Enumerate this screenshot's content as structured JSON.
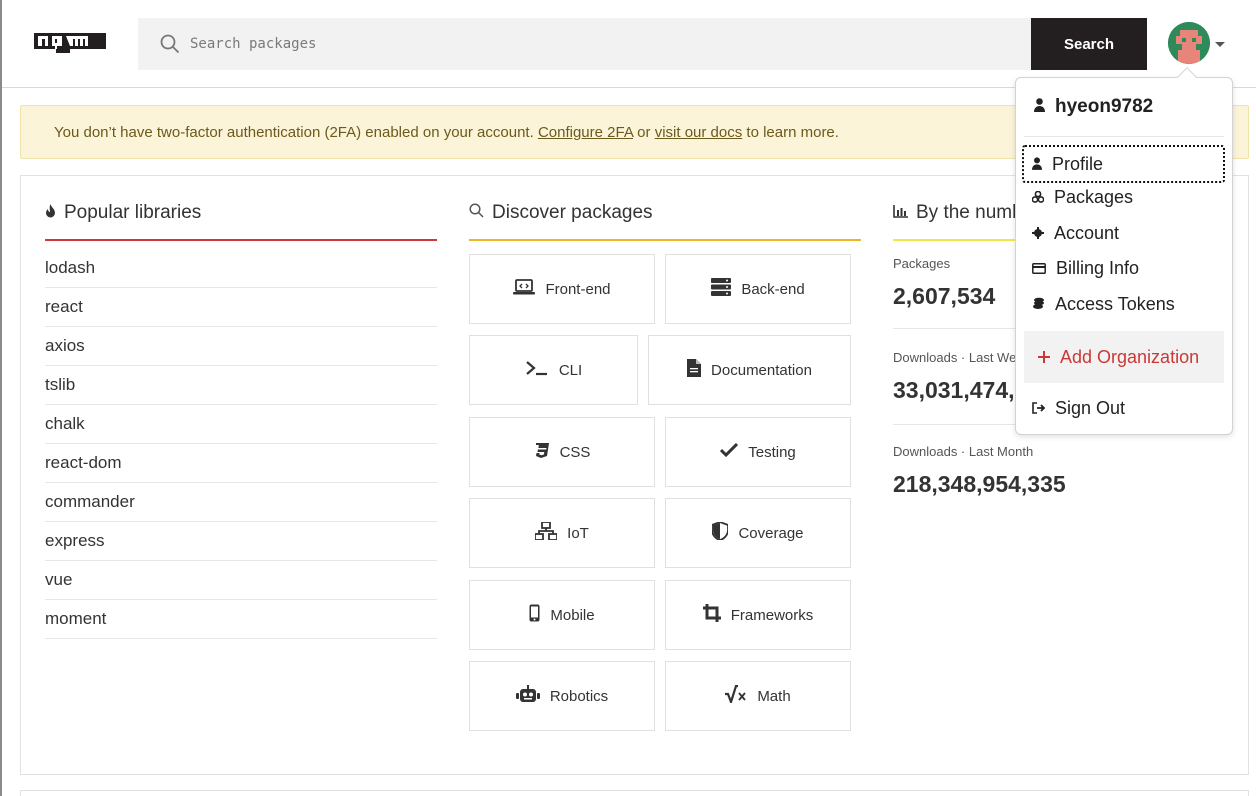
{
  "header": {
    "search_placeholder": "Search packages",
    "search_button": "Search"
  },
  "banner": {
    "text_before": "You don’t have two-factor authentication (2FA) enabled on your account. ",
    "link1": "Configure 2FA",
    "text_mid": " or ",
    "link2": "visit our docs",
    "text_after": " to learn more."
  },
  "popular": {
    "title": "Popular libraries",
    "items": [
      "lodash",
      "react",
      "axios",
      "tslib",
      "chalk",
      "react-dom",
      "commander",
      "express",
      "vue",
      "moment"
    ]
  },
  "discover": {
    "title": "Discover packages",
    "tiles": [
      "Front-end",
      "Back-end",
      "CLI",
      "Documentation",
      "CSS",
      "Testing",
      "IoT",
      "Coverage",
      "Mobile",
      "Frameworks",
      "Robotics",
      "Math"
    ]
  },
  "numbers": {
    "title": "By the numb",
    "stats": [
      {
        "label": "Packages",
        "value": "2,607,534"
      },
      {
        "label": "Downloads · Last We",
        "value": "33,031,474,"
      },
      {
        "label": "Downloads · Last Month",
        "value": "218,348,954,335"
      }
    ]
  },
  "dropdown": {
    "username": "hyeon9782",
    "items": [
      "Profile",
      "Packages",
      "Account",
      "Billing Info",
      "Access Tokens"
    ],
    "add_org": "Add Organization",
    "sign_out": "Sign Out"
  },
  "colors": {
    "brand_red": "#cb3837",
    "popular_rule": "#cb3837",
    "discover_rule": "#f0b429",
    "numbers_rule": "#f5e44a",
    "banner_bg": "#fbf4d9"
  }
}
